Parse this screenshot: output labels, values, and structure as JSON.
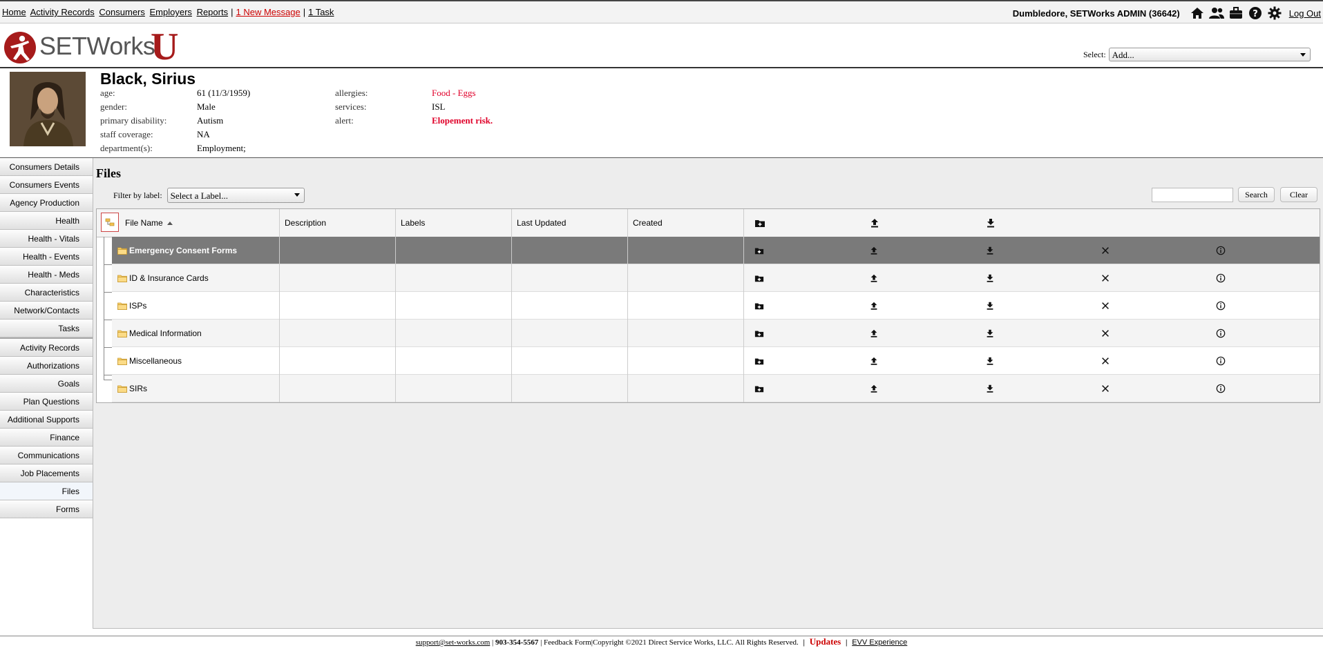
{
  "topnav": {
    "links": [
      "Home",
      "Activity Records",
      "Consumers",
      "Employers",
      "Reports"
    ],
    "separator": "|",
    "messages": "1 New Message",
    "tasks": "1 Task"
  },
  "user": {
    "label": "Dumbledore, SETWorks ADMIN  (36642)",
    "logout": "Log Out",
    "icons": [
      "home-icon",
      "users-icon",
      "briefcase-icon",
      "help-icon",
      "gear-icon"
    ]
  },
  "logo": {
    "text": "SETWorks",
    "u": "U"
  },
  "select_add": {
    "label": "Select:",
    "value": "Add..."
  },
  "person": {
    "name": "Black, Sirius",
    "fields_left": [
      {
        "label": "age:",
        "value": "61 (11/3/1959)"
      },
      {
        "label": "gender:",
        "value": "Male"
      },
      {
        "label": "primary disability:",
        "value": "Autism"
      },
      {
        "label": "staff coverage:",
        "value": "NA"
      },
      {
        "label": "department(s):",
        "value": "Employment;"
      }
    ],
    "fields_right": [
      {
        "label": "allergies:",
        "value": "Food - Eggs"
      },
      {
        "label": "services:",
        "value": "ISL"
      },
      {
        "label": "alert:",
        "value": "Elopement risk."
      }
    ]
  },
  "sidebar": {
    "group1": [
      "Consumers Details",
      "Consumers Events",
      "Agency Production",
      "Health",
      "Health - Vitals",
      "Health - Events",
      "Health - Meds",
      "Characteristics",
      "Network/Contacts",
      "Tasks"
    ],
    "group2": [
      "Activity Records",
      "Authorizations",
      "Goals",
      "Plan Questions",
      "Additional Supports",
      "Finance",
      "Communications",
      "Job Placements",
      "Files",
      "Forms"
    ],
    "active": "Files"
  },
  "files": {
    "title": "Files",
    "filter_label": "Filter by label:",
    "filter_value": "Select a Label...",
    "search_btn": "Search",
    "clear_btn": "Clear",
    "columns": [
      "File Name",
      "Description",
      "Labels",
      "Last Updated",
      "Created"
    ],
    "rows": [
      {
        "name": "Emergency Consent Forms",
        "selected": true
      },
      {
        "name": "ID & Insurance Cards",
        "selected": false
      },
      {
        "name": "ISPs",
        "selected": false
      },
      {
        "name": "Medical Information",
        "selected": false
      },
      {
        "name": "Miscellaneous",
        "selected": false
      },
      {
        "name": "SIRs",
        "selected": false
      }
    ]
  },
  "footer": {
    "email": "support@set-works.com",
    "phone": "903-354-5567",
    "feedback": "Feedback Form",
    "copyright": "Copyright ©2021 Direct Service Works, LLC. All Rights Reserved.",
    "updates": "Updates",
    "evv": "EVV Experience"
  }
}
